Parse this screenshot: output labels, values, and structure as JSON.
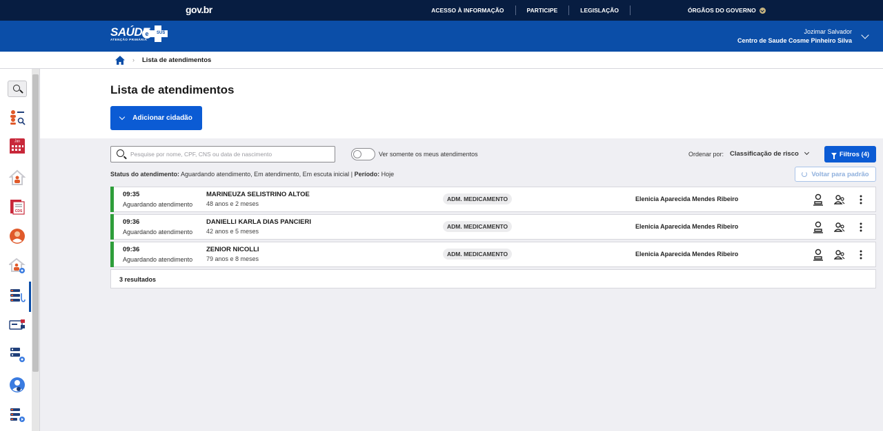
{
  "gov_bar": {
    "logo": "gov.br",
    "links": [
      "ACESSO À INFORMAÇÃO",
      "PARTICIPE",
      "LEGISLAÇÃO"
    ],
    "orgaos": "ÓRGÃOS DO GOVERNO"
  },
  "header": {
    "brand_name": "SAÚDE",
    "brand_sub": "ATENÇÃO PRIMÁRIA",
    "brand_e": "e",
    "brand_sus": "SUS",
    "user_name": "Jozimar Salvador",
    "unit_name": "Centro de Saude Cosme Pinheiro Silva"
  },
  "breadcrumb": {
    "current": "Lista de atendimentos"
  },
  "sidebar": {
    "items": [
      {
        "icon": "search-icon"
      },
      {
        "icon": "patient-search-icon"
      },
      {
        "icon": "calendar-icon",
        "label": "Jan"
      },
      {
        "icon": "home-visit-icon"
      },
      {
        "icon": "cds-document-icon",
        "label": "CDS"
      },
      {
        "icon": "citizen-icon"
      },
      {
        "icon": "home-settings-icon"
      },
      {
        "icon": "attendance-list-icon"
      },
      {
        "icon": "id-card-icon"
      },
      {
        "icon": "list-settings-icon"
      },
      {
        "icon": "user-check-icon"
      },
      {
        "icon": "list-play-icon"
      }
    ]
  },
  "main": {
    "title": "Lista de atendimentos",
    "add_button": "Adicionar cidadão",
    "search_placeholder": "Pesquise por nome, CPF, CNS ou data de nascimento",
    "toggle_label": "Ver somente os meus atendimentos",
    "order_label": "Ordenar por:",
    "order_value": "Classificação de risco",
    "filter_button": "Filtros (4)",
    "status_label": "Status do atendimento:",
    "status_value": "Aguardando atendimento, Em atendimento, Em escuta inicial",
    "period_sep": "|",
    "period_label": "Período:",
    "period_value": "Hoje",
    "reset_button": "Voltar para padrão",
    "results": "3 resultados"
  },
  "rows": [
    {
      "time": "09:35",
      "state": "Aguardando atendimento",
      "name": "MARINEUZA SELISTRINO ALTOE",
      "age": "48 anos e 2 meses",
      "tag": "ADM. MEDICAMENTO",
      "professional": "Elenicia Aparecida Mendes Ribeiro"
    },
    {
      "time": "09:36",
      "state": "Aguardando atendimento",
      "name": "DANIELLI KARLA DIAS PANCIERI",
      "age": "42 anos e 5 meses",
      "tag": "ADM. MEDICAMENTO",
      "professional": "Elenicia Aparecida Mendes Ribeiro"
    },
    {
      "time": "09:36",
      "state": "Aguardando atendimento",
      "name": "ZENIOR NICOLLI",
      "age": "79 anos e 8 meses",
      "tag": "ADM. MEDICAMENTO",
      "professional": "Elenicia Aparecida Mendes Ribeiro"
    }
  ],
  "colors": {
    "gov_navy": "#071d41",
    "header_blue": "#0b4ea8",
    "primary_button": "#0b5bd4",
    "status_green": "#2e9e3a"
  }
}
